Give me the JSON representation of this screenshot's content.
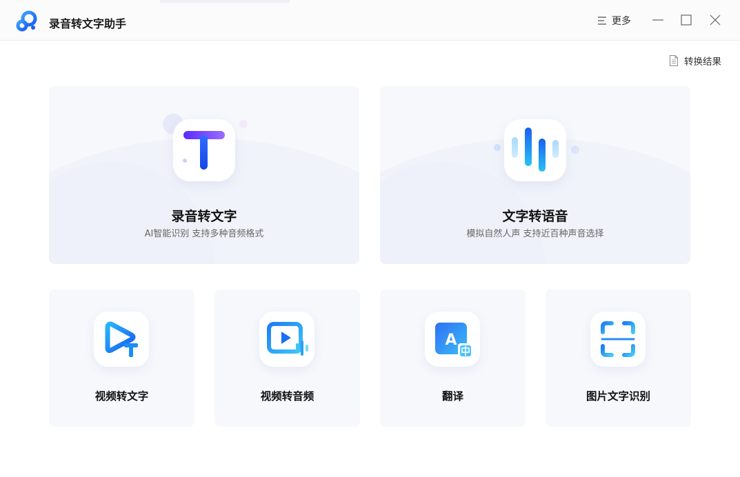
{
  "app": {
    "title": "录音转文字助手",
    "more_label": "更多",
    "results_label": "转换结果"
  },
  "colors": {
    "accent": "#1a6ef5",
    "card_bg": "#f7f8fc",
    "titlebar_bg": "#fbfbfc"
  },
  "features": {
    "big": [
      {
        "title": "录音转文字",
        "subtitle": "AI智能识别 支持多种音频格式",
        "icon": "text-T-icon"
      },
      {
        "title": "文字转语音",
        "subtitle": "模拟自然人声 支持近百种声音选择",
        "icon": "sound-wave-icon"
      }
    ],
    "small": [
      {
        "title": "视频转文字",
        "icon": "video-to-text-icon"
      },
      {
        "title": "视频转音频",
        "icon": "video-to-audio-icon"
      },
      {
        "title": "翻译",
        "icon": "translate-icon"
      },
      {
        "title": "图片文字识别",
        "icon": "scan-icon"
      }
    ]
  }
}
